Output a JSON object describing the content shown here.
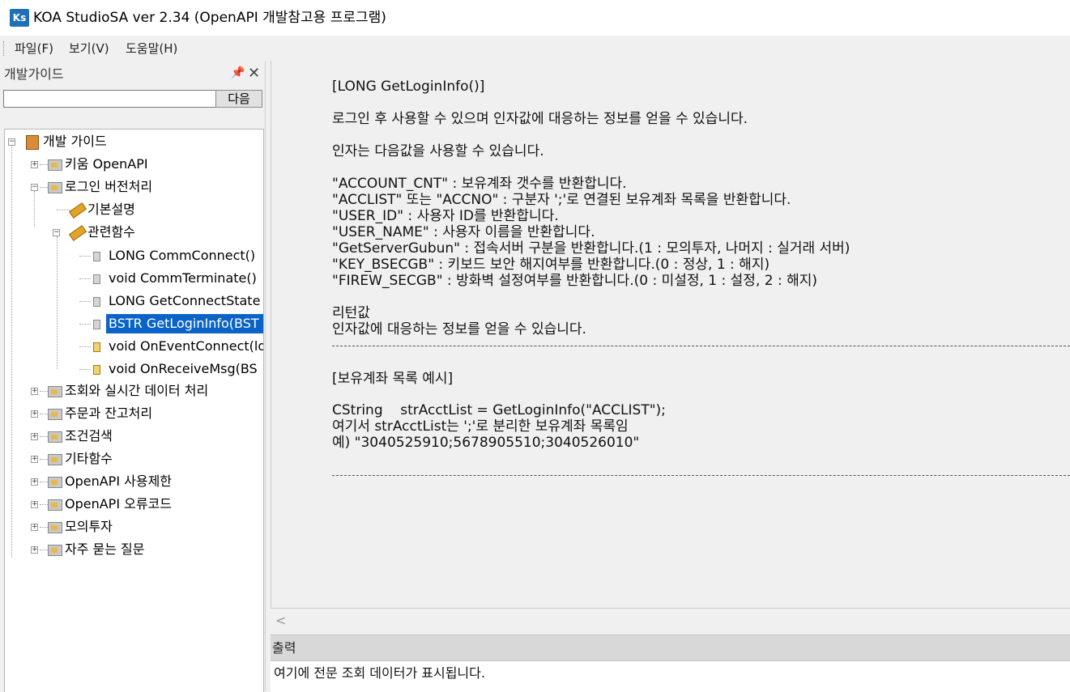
{
  "window": {
    "app_icon_text": "Ks",
    "title": "KOA StudioSA ver 2.34  (OpenAPI 개발참고용 프로그램)"
  },
  "menu": {
    "items": [
      "파일(F)",
      "보기(V)",
      "도움말(H)"
    ]
  },
  "left_panel": {
    "title": "개발가이드",
    "search_value": "",
    "next_label": "다음",
    "tree": {
      "root": "개발 가이드",
      "items": [
        "키움 OpenAPI",
        "로그인 버전처리",
        "기본설명",
        "관련함수",
        "LONG CommConnect()",
        "void CommTerminate()",
        "LONG GetConnectState",
        "BSTR GetLoginInfo(BST",
        "void OnEventConnect(lo",
        "void OnReceiveMsg(BS",
        "조회와 실시간 데이터 처리",
        "주문과 잔고처리",
        "조건검색",
        "기타함수",
        "OpenAPI 사용제한",
        "OpenAPI 오류코드",
        "모의투자",
        "자주 묻는 질문"
      ]
    }
  },
  "content": {
    "heading": "[LONG GetLoginInfo()]",
    "intro": "로그인 후 사용할 수 있으며 인자값에 대응하는 정보를 얻을 수 있습니다.",
    "args_intro": "인자는 다음값을 사용할 수 있습니다.",
    "args": [
      "\"ACCOUNT_CNT\" : 보유계좌 갯수를 반환합니다.",
      "\"ACCLIST\" 또는 \"ACCNO\" : 구분자 ';'로 연결된 보유계좌 목록을 반환합니다.",
      "\"USER_ID\" : 사용자 ID를 반환합니다.",
      "\"USER_NAME\" : 사용자 이름을 반환합니다.",
      "\"GetServerGubun\" : 접속서버 구분을 반환합니다.(1 : 모의투자, 나머지 : 실거래 서버)",
      "\"KEY_BSECGB\" : 키보드 보안 해지여부를 반환합니다.(0 : 정상, 1 : 해지)",
      "\"FIREW_SECGB\" : 방화벽 설정여부를 반환합니다.(0 : 미설정, 1 : 설정, 2 : 해지)"
    ],
    "return_label": "리턴값",
    "return_desc": "인자값에 대응하는 정보를 얻을 수 있습니다.",
    "example_heading": "[보유계좌 목록 예시]",
    "example": [
      "CString    strAcctList = GetLoginInfo(\"ACCLIST\");",
      "여기서 strAcctList는 ';'로 분리한 보유계좌 목록임",
      "예) \"3040525910;5678905510;3040526010\""
    ]
  },
  "output": {
    "title": "출력",
    "text": "여기에 전문 조회 데이터가 표시됩니다."
  }
}
